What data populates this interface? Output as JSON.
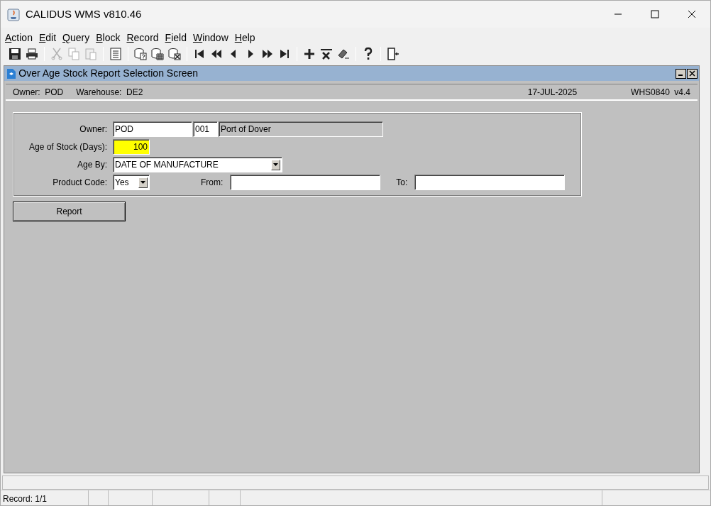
{
  "window": {
    "title": "CALIDUS WMS v810.46"
  },
  "menu": [
    {
      "label": "Action"
    },
    {
      "label": "Edit"
    },
    {
      "label": "Query"
    },
    {
      "label": "Block"
    },
    {
      "label": "Record"
    },
    {
      "label": "Field"
    },
    {
      "label": "Window"
    },
    {
      "label": "Help"
    }
  ],
  "toolbar": [
    [
      {
        "disabled": false
      },
      {
        "disabled": false
      }
    ],
    [
      {
        "disabled": true
      },
      {
        "disabled": true
      },
      {
        "disabled": true
      }
    ],
    [
      {
        "disabled": false
      }
    ],
    [
      {
        "disabled": false
      },
      {
        "disabled": false
      },
      {
        "disabled": false
      }
    ],
    [
      {
        "disabled": false
      },
      {
        "disabled": false
      },
      {
        "disabled": false
      },
      {
        "disabled": false
      },
      {
        "disabled": false
      },
      {
        "disabled": false
      }
    ],
    [
      {
        "disabled": false
      },
      {
        "disabled": false
      },
      {
        "disabled": false
      }
    ],
    [
      {
        "disabled": false
      }
    ],
    [
      {
        "disabled": false
      }
    ]
  ],
  "form_window": {
    "title": "Over Age Stock Report Selection Screen",
    "info": {
      "owner_label": "Owner:",
      "owner": "POD",
      "warehouse_label": "Warehouse:",
      "warehouse": "DE2",
      "date": "17-JUL-2025",
      "module": "WHS0840",
      "version": "v4.4"
    },
    "fields": {
      "owner": {
        "label": "Owner:",
        "code": "POD",
        "number": "001",
        "name": "Port of Dover"
      },
      "age_of_stock": {
        "label": "Age of Stock (Days):",
        "value": "100",
        "highlighted": true
      },
      "age_by": {
        "label": "Age By:",
        "value": "DATE OF MANUFACTURE"
      },
      "product_code": {
        "label": "Product Code:",
        "value": "Yes",
        "from_label": "From:",
        "to_label": "To:"
      }
    },
    "report_button": "Report"
  },
  "status_bar": {
    "record": "Record: 1/1"
  }
}
